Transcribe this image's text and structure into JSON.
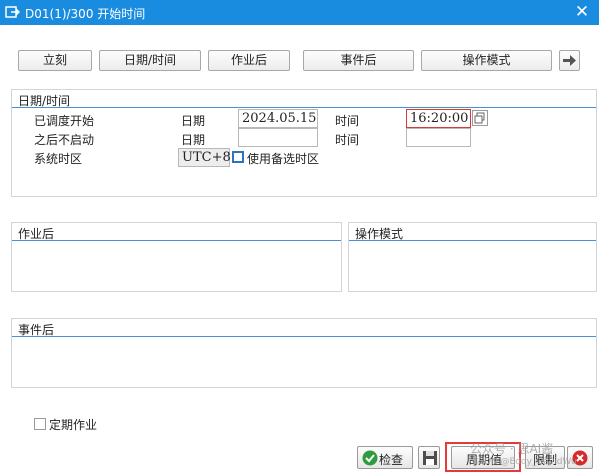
{
  "window": {
    "title": "D01(1)/300 开始时间",
    "close_glyph": "✕"
  },
  "toolbar": {
    "immediate": "立刻",
    "datetime": "日期/时间",
    "after_job": "作业后",
    "after_event": "事件后",
    "op_mode": "操作模式"
  },
  "datetime_group": {
    "title": "日期/时间",
    "scheduled_start_label": "已调度开始",
    "not_after_label": "之后不启动",
    "timezone_label": "系统时区",
    "date_label": "日期",
    "time_label": "时间",
    "start_date": "2024.05.15",
    "start_time": "16:20:00",
    "not_after_date": "",
    "not_after_time": "",
    "timezone_value": "UTC+8",
    "alt_tz_label": "使用备选时区"
  },
  "after_job_group": {
    "title": "作业后"
  },
  "op_mode_group": {
    "title": "操作模式"
  },
  "after_event_group": {
    "title": "事件后"
  },
  "periodic_job_label": "定期作业",
  "buttons": {
    "check": "检查",
    "period": "周期值",
    "limit": "限制"
  },
  "watermarks": {
    "line1": "公众号 · 思AI酱",
    "line2": "CSDN @Eddy_DavidWu"
  },
  "colors": {
    "title_bar": "#1a8ce0",
    "group_line": "#4a8fd8",
    "highlight": "#e53a3a",
    "cancel_red": "#d42a2a",
    "check_green": "#2e9b3e"
  }
}
